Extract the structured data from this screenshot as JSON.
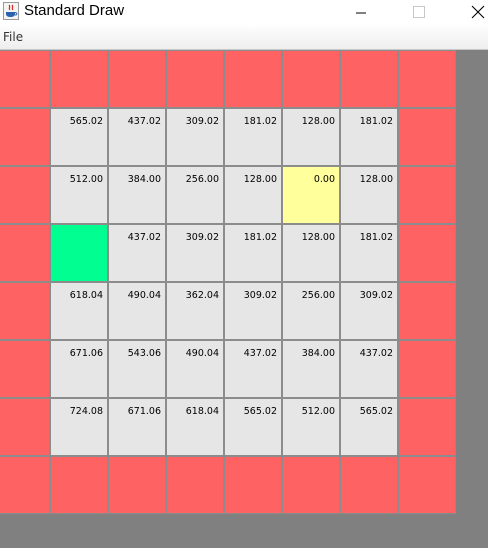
{
  "window": {
    "title": "Standard Draw",
    "app_icon": "java-coffee-cup-icon",
    "controls": [
      "minimize-icon",
      "maximize-icon",
      "close-icon"
    ]
  },
  "menu": {
    "file_label": "File"
  },
  "colors": {
    "wall": "#ff6262",
    "free": "#e6e6e6",
    "goal": "#ffff9c",
    "start": "#00ff90",
    "background": "#808080"
  },
  "grid": {
    "rows": [
      [
        {
          "type": "wall"
        },
        {
          "type": "wall"
        },
        {
          "type": "wall"
        },
        {
          "type": "wall"
        },
        {
          "type": "wall"
        },
        {
          "type": "wall"
        },
        {
          "type": "wall"
        },
        {
          "type": "wall"
        }
      ],
      [
        {
          "type": "wall"
        },
        {
          "type": "free",
          "label": "565.02"
        },
        {
          "type": "free",
          "label": "437.02"
        },
        {
          "type": "free",
          "label": "309.02"
        },
        {
          "type": "free",
          "label": "181.02"
        },
        {
          "type": "free",
          "label": "128.00"
        },
        {
          "type": "free",
          "label": "181.02"
        },
        {
          "type": "wall"
        }
      ],
      [
        {
          "type": "wall"
        },
        {
          "type": "free",
          "label": "512.00"
        },
        {
          "type": "free",
          "label": "384.00"
        },
        {
          "type": "free",
          "label": "256.00"
        },
        {
          "type": "free",
          "label": "128.00"
        },
        {
          "type": "goal",
          "label": "0.00"
        },
        {
          "type": "free",
          "label": "128.00"
        },
        {
          "type": "wall"
        }
      ],
      [
        {
          "type": "wall"
        },
        {
          "type": "start"
        },
        {
          "type": "free",
          "label": "437.02"
        },
        {
          "type": "free",
          "label": "309.02"
        },
        {
          "type": "free",
          "label": "181.02"
        },
        {
          "type": "free",
          "label": "128.00"
        },
        {
          "type": "free",
          "label": "181.02"
        },
        {
          "type": "wall"
        }
      ],
      [
        {
          "type": "wall"
        },
        {
          "type": "free",
          "label": "618.04"
        },
        {
          "type": "free",
          "label": "490.04"
        },
        {
          "type": "free",
          "label": "362.04"
        },
        {
          "type": "free",
          "label": "309.02"
        },
        {
          "type": "free",
          "label": "256.00"
        },
        {
          "type": "free",
          "label": "309.02"
        },
        {
          "type": "wall"
        }
      ],
      [
        {
          "type": "wall"
        },
        {
          "type": "free",
          "label": "671.06"
        },
        {
          "type": "free",
          "label": "543.06"
        },
        {
          "type": "free",
          "label": "490.04"
        },
        {
          "type": "free",
          "label": "437.02"
        },
        {
          "type": "free",
          "label": "384.00"
        },
        {
          "type": "free",
          "label": "437.02"
        },
        {
          "type": "wall"
        }
      ],
      [
        {
          "type": "wall"
        },
        {
          "type": "free",
          "label": "724.08"
        },
        {
          "type": "free",
          "label": "671.06"
        },
        {
          "type": "free",
          "label": "618.04"
        },
        {
          "type": "free",
          "label": "565.02"
        },
        {
          "type": "free",
          "label": "512.00"
        },
        {
          "type": "free",
          "label": "565.02"
        },
        {
          "type": "wall"
        }
      ],
      [
        {
          "type": "wall"
        },
        {
          "type": "wall"
        },
        {
          "type": "wall"
        },
        {
          "type": "wall"
        },
        {
          "type": "wall"
        },
        {
          "type": "wall"
        },
        {
          "type": "wall"
        },
        {
          "type": "wall"
        }
      ]
    ]
  }
}
